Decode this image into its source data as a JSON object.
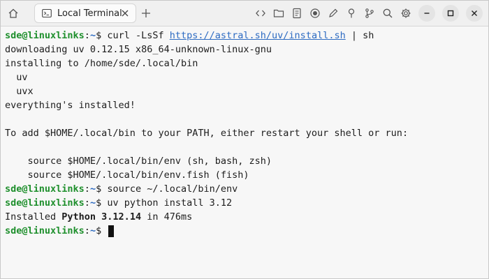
{
  "tab": {
    "title": "Local Terminal"
  },
  "prompt": {
    "user_host": "sde@linuxlinks",
    "sep": ":",
    "path": "~",
    "dollar": "$ "
  },
  "lines": {
    "l0_cmd_a": "curl -LsSf ",
    "l0_url": "https://astral.sh/uv/install.sh",
    "l0_cmd_b": " | sh",
    "l1": "downloading uv 0.12.15 x86_64-unknown-linux-gnu",
    "l2": "installing to /home/sde/.local/bin",
    "l3": "  uv",
    "l4": "  uvx",
    "l5": "everything's installed!",
    "l6": "",
    "l7": "To add $HOME/.local/bin to your PATH, either restart your shell or run:",
    "l8": "",
    "l9": "    source $HOME/.local/bin/env (sh, bash, zsh)",
    "l10": "    source $HOME/.local/bin/env.fish (fish)",
    "l11_cmd": "source ~/.local/bin/env",
    "l12_cmd": "uv python install 3.12",
    "l13_a": "Installed ",
    "l13_b": "Python 3.12.14",
    "l13_c": " in 476ms"
  },
  "icons": {
    "home": "home-icon",
    "terminal": "terminal-icon",
    "close": "close-icon",
    "add": "plus-icon",
    "code": "code-icon",
    "folder": "folder-icon",
    "document": "document-icon",
    "record": "record-icon",
    "edit": "pencil-icon",
    "pin": "pin-icon",
    "git": "git-branch-icon",
    "search": "search-icon",
    "settings": "gear-icon",
    "minimize": "minimize-icon",
    "maximize": "maximize-icon",
    "window_close": "window-close-icon"
  },
  "colors": {
    "user": "#1e8f2c",
    "path": "#2d6bc2",
    "link": "#2d6bc2",
    "text": "#1d1d1d"
  }
}
